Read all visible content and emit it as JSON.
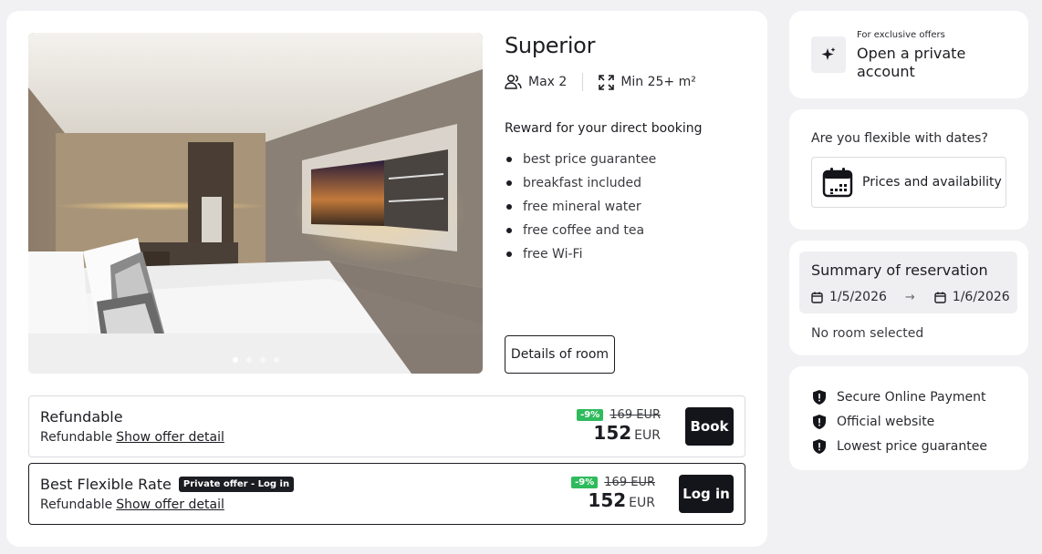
{
  "room": {
    "title": "Superior",
    "capacity": "Max 2",
    "size": "Min 25+ m²",
    "reward_title": "Reward for your direct booking",
    "benefits": [
      "best price guarantee",
      "breakfast included",
      "free mineral water",
      "free coffee and tea",
      "free Wi-Fi"
    ],
    "details_button": "Details of room",
    "gallery_total_slides": 4,
    "gallery_active_slide": 1
  },
  "offers": [
    {
      "name": "Refundable",
      "badge": "",
      "policy": "Refundable",
      "detail_link": "Show offer detail",
      "discount": "-9%",
      "old_price": "169 EUR",
      "price": "152",
      "currency": "EUR",
      "action": "Book"
    },
    {
      "name": "Best Flexible Rate",
      "badge": "Private offer  - Log in",
      "policy": "Refundable",
      "detail_link": "Show offer detail",
      "discount": "-9%",
      "old_price": "169 EUR",
      "price": "152",
      "currency": "EUR",
      "action": "Log in"
    }
  ],
  "sidebar": {
    "exclusive_small": "For exclusive offers",
    "open_account": "Open a private account",
    "flexible_question": "Are you flexible with dates?",
    "prices_button": "Prices and availability",
    "summary_title": "Summary of reservation",
    "date_from": "1/5/2026",
    "date_arrow": "→",
    "date_to": "1/6/2026",
    "no_room": "No room selected",
    "trust": [
      "Secure Online Payment",
      "Official website",
      "Lowest price guarantee"
    ]
  },
  "icons": {
    "people": "people-icon",
    "expand": "expand-icon",
    "sparkle": "sparkle-icon",
    "calendar": "calendar-icon",
    "shield": "shield-icon"
  },
  "colors": {
    "page_bg": "#f1f1f3",
    "primary_dark": "#14151a",
    "discount_green": "#2fbb5d"
  }
}
